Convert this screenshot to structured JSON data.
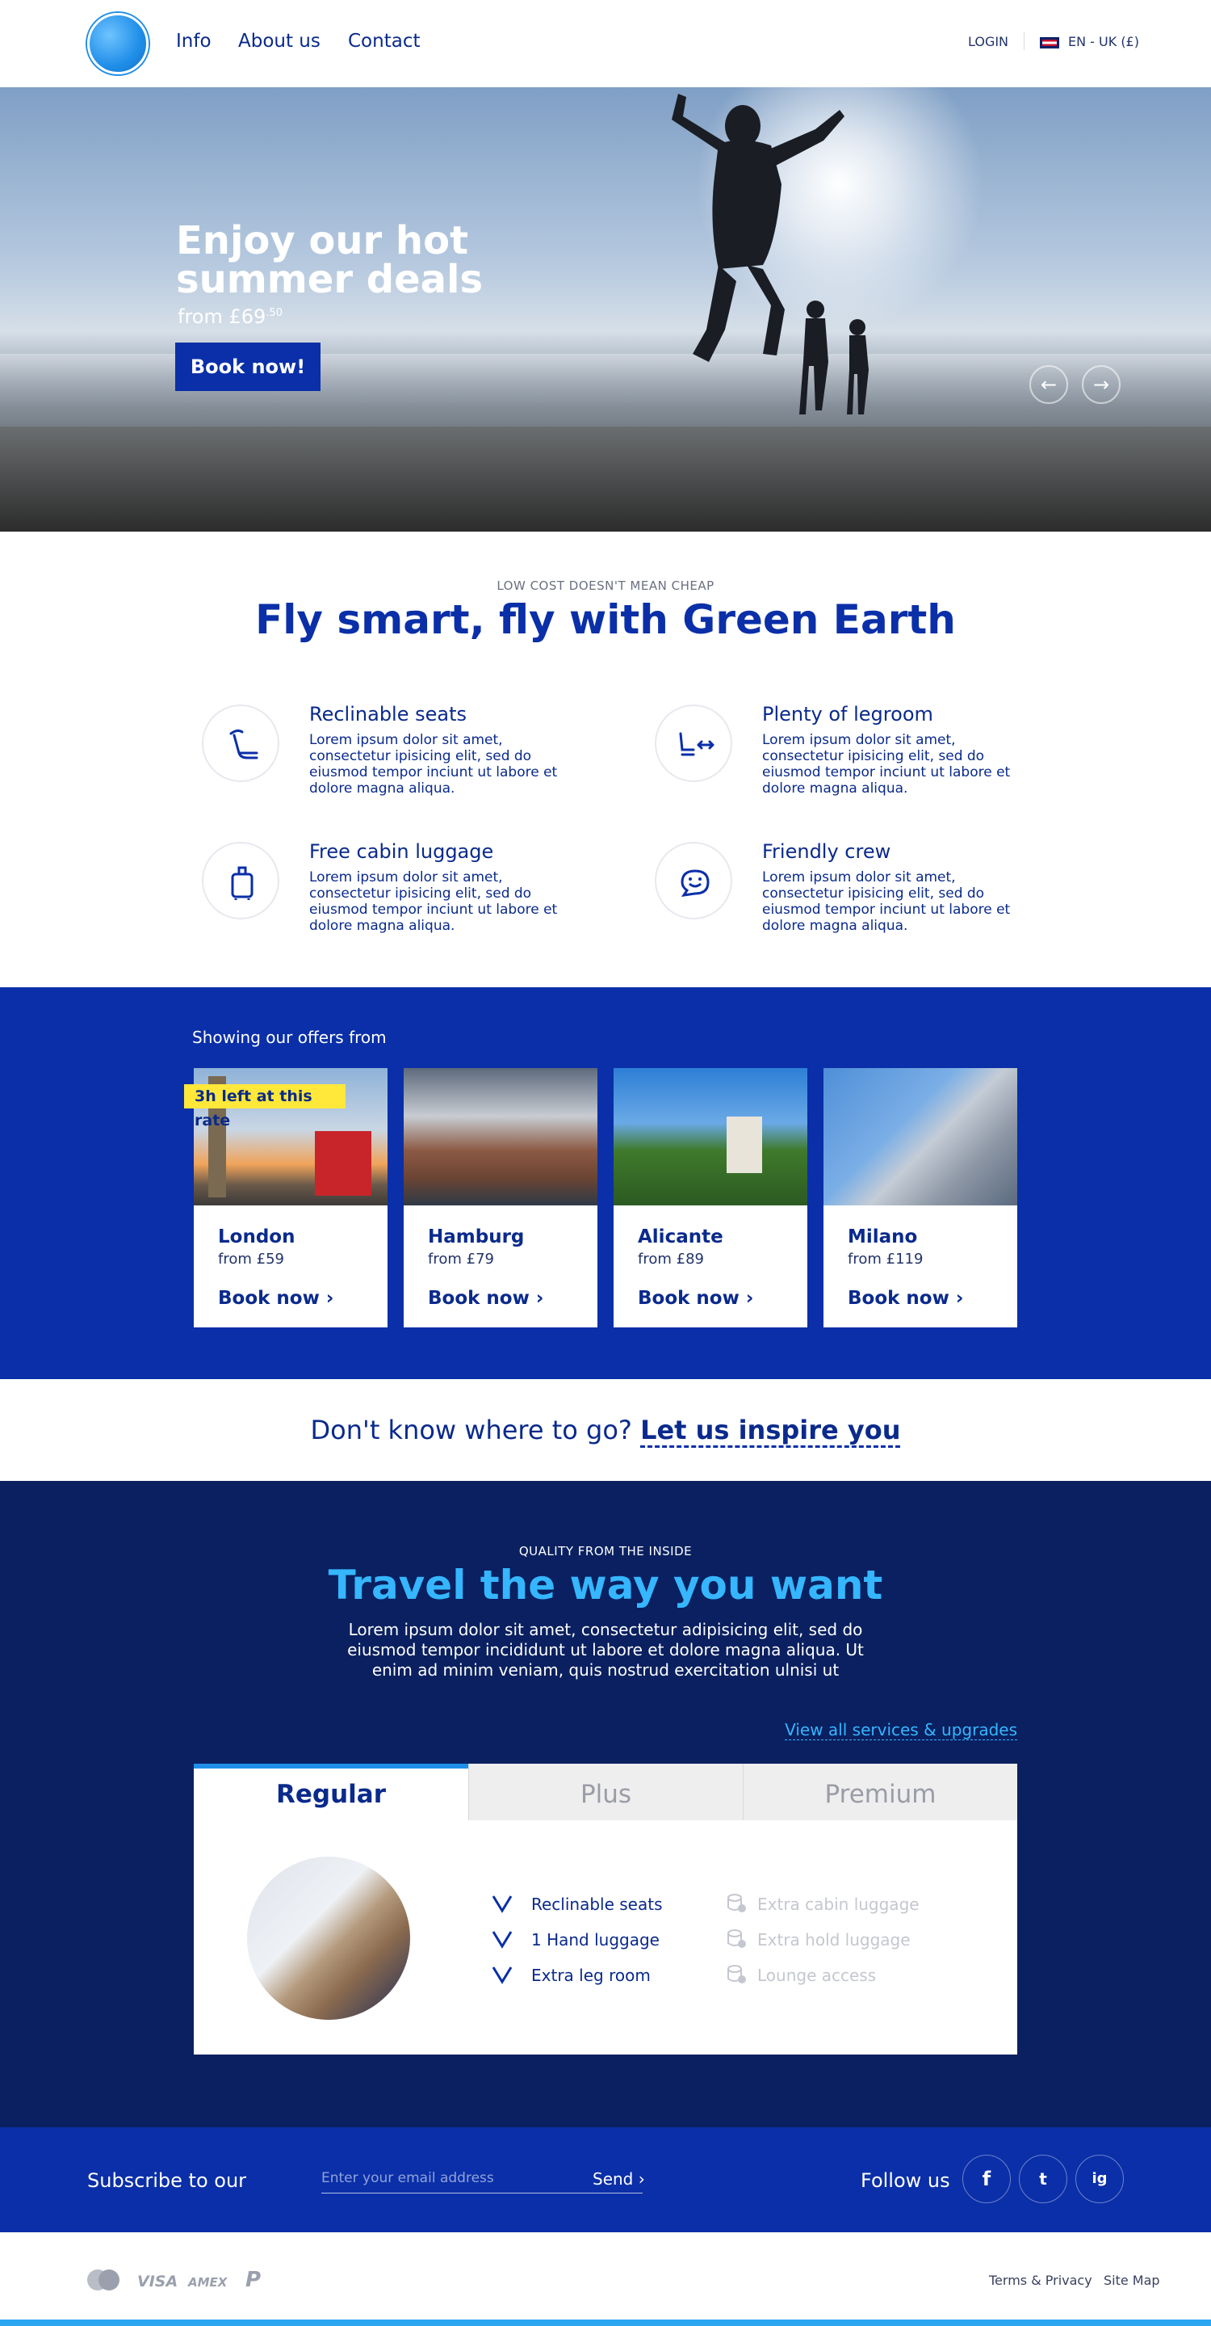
{
  "header": {
    "nav": [
      "Info",
      "About us",
      "Contact"
    ],
    "login": "LOGIN",
    "locale": "EN - UK (£)"
  },
  "hero": {
    "title": "Enjoy our hot summer deals",
    "price_prefix": "from £69",
    "price_cents": ".50",
    "cta": "Book now!",
    "prev_icon": "←",
    "next_icon": "→"
  },
  "features": {
    "eyebrow": "LOW COST DOESN'T MEAN CHEAP",
    "title": "Fly smart, fly with Green Earth",
    "items": [
      {
        "icon": "seat-icon",
        "title": "Reclinable seats",
        "text": "Lorem ipsum dolor sit amet, consectetur ipisicing elit, sed do eiusmod tempor inciunt ut labore et dolore magna aliqua."
      },
      {
        "icon": "legroom-icon",
        "title": "Plenty of legroom",
        "text": "Lorem ipsum dolor sit amet, consectetur ipisicing elit, sed do eiusmod tempor inciunt ut labore et dolore magna aliqua."
      },
      {
        "icon": "luggage-icon",
        "title": "Free cabin luggage",
        "text": "Lorem ipsum dolor sit amet, consectetur ipisicing elit, sed do eiusmod tempor inciunt ut labore et dolore magna aliqua."
      },
      {
        "icon": "chat-icon",
        "title": "Friendly crew",
        "text": "Lorem ipsum dolor sit amet, consectetur ipisicing elit, sed do eiusmod tempor inciunt ut labore et dolore magna aliqua."
      }
    ]
  },
  "offers": {
    "label": "Showing our offers from",
    "badge": "3h left at this rate",
    "cards": [
      {
        "city": "London",
        "from": "from £59",
        "cta": "Book now"
      },
      {
        "city": "Hamburg",
        "from": "from £79",
        "cta": "Book now"
      },
      {
        "city": "Alicante",
        "from": "from £89",
        "cta": "Book now"
      },
      {
        "city": "Milano",
        "from": "from £119",
        "cta": "Book now"
      }
    ]
  },
  "inspire": {
    "question": "Don't know where to go?",
    "link": "Let us inspire you"
  },
  "travel": {
    "eyebrow": "QUALITY FROM THE INSIDE",
    "title": "Travel the way you want",
    "lead": "Lorem ipsum dolor sit amet, consectetur adipisicing elit, sed do eiusmod tempor incididunt ut labore et dolore magna aliqua. Ut enim ad minim veniam, quis nostrud exercitation ulnisi ut",
    "view_all": "View all services & upgrades",
    "tabs": [
      "Regular",
      "Plus",
      "Premium"
    ],
    "included": [
      "Reclinable seats",
      "1 Hand luggage",
      "Extra leg room"
    ],
    "excluded": [
      "Extra cabin luggage",
      "Extra hold luggage",
      "Lounge access"
    ]
  },
  "subscribe": {
    "label": "Subscribe to our",
    "placeholder": "Enter your email address",
    "send": "Send",
    "follow": "Follow us",
    "social": [
      "f",
      "t",
      "ig"
    ]
  },
  "footer": {
    "payments": [
      "VISA",
      "AMEX"
    ],
    "links": [
      "Terms & Privacy",
      "Site Map"
    ]
  },
  "colors": {
    "brand": "#0a2fa8",
    "navy": "#0a2060",
    "accent": "#35b6ff",
    "badge": "#ffe83a"
  }
}
